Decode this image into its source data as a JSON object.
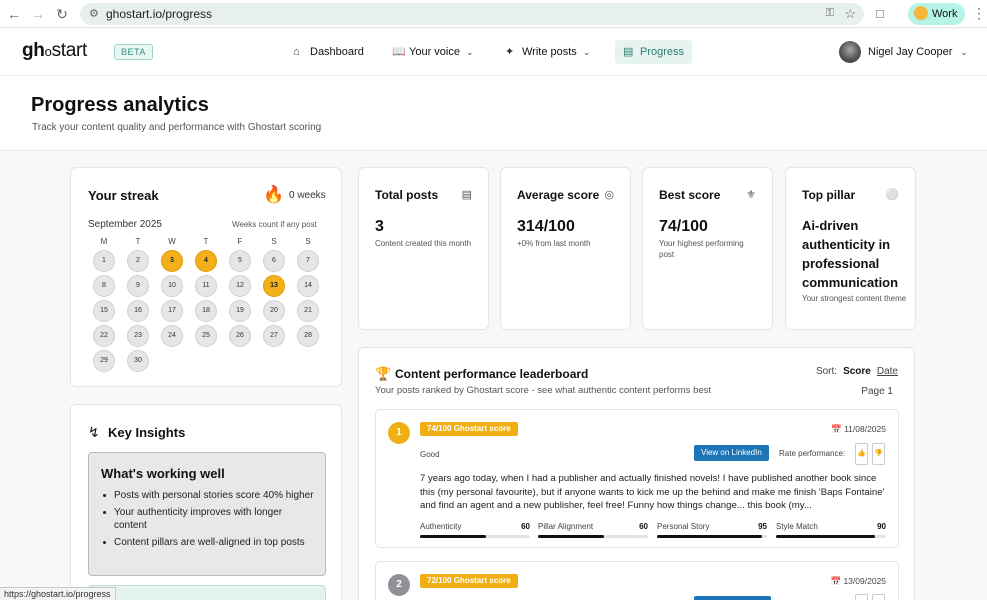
{
  "browser": {
    "url": "ghostart.io/progress",
    "profile_label": "Work",
    "status_url": "https://ghostart.io/progress"
  },
  "header": {
    "logo_left": "gh",
    "logo_mid": "o",
    "logo_right": "start",
    "badge": "BETA",
    "nav": {
      "dashboard": "Dashboard",
      "your_voice": "Your voice",
      "write_posts": "Write posts",
      "progress": "Progress"
    },
    "user_name": "Nigel Jay Cooper"
  },
  "page": {
    "title": "Progress analytics",
    "subtitle": "Track your content quality and performance with Ghostart scoring"
  },
  "streak": {
    "title": "Your streak",
    "weeks": "0 weeks",
    "month": "September 2025",
    "note": "Weeks count if any post",
    "weekdays": [
      "M",
      "T",
      "W",
      "T",
      "F",
      "S",
      "S"
    ],
    "active_days": [
      3,
      4,
      13
    ],
    "days_in_month": 30
  },
  "stats": {
    "total_posts": {
      "title": "Total posts",
      "value": "3",
      "sub": "Content created this month"
    },
    "average_score": {
      "title": "Average score",
      "value": "314/100",
      "sub": "+0% from last month"
    },
    "best_score": {
      "title": "Best score",
      "value": "74/100",
      "sub": "Your highest performing post"
    },
    "top_pillar": {
      "title": "Top pillar",
      "value": "Ai-driven authenticity in professional communication",
      "sub": "Your strongest content theme"
    }
  },
  "insights": {
    "title": "Key Insights",
    "working_title": "What's working well",
    "items": [
      "Posts with personal stories score 40% higher",
      "Your authenticity improves with longer content",
      "Content pillars are well-aligned in top posts"
    ]
  },
  "leaderboard": {
    "title": "Content performance leaderboard",
    "subtitle": "Your posts ranked by Ghostart score - see what authentic content performs best",
    "sort_label": "Sort:",
    "sort_score": "Score",
    "sort_date": "Date",
    "page": "Page 1",
    "posts": [
      {
        "rank": "1",
        "score_badge": "74/100 Ghostart score",
        "date": "11/08/2025",
        "grade": "Good",
        "linkedin": "View on LinkedIn",
        "rate": "Rate performance:",
        "excerpt": "7 years ago today, when I had a publisher and actually finished novels! I have published another book since this (my personal favourite), but if anyone wants to kick me up the behind and make me finish 'Baps Fontaine' and find an agent and a new publisher, feel free! Funny how things change... this book (my...",
        "metrics": [
          {
            "label": "Authenticity",
            "value": "60",
            "fraction": 0.6
          },
          {
            "label": "Pillar Alignment",
            "value": "60",
            "fraction": 0.6
          },
          {
            "label": "Personal Story",
            "value": "95",
            "fraction": 0.95
          },
          {
            "label": "Style Match",
            "value": "90",
            "fraction": 0.9
          }
        ]
      },
      {
        "rank": "2",
        "score_badge": "72/100 Ghostart score",
        "date": "13/09/2025"
      }
    ]
  }
}
